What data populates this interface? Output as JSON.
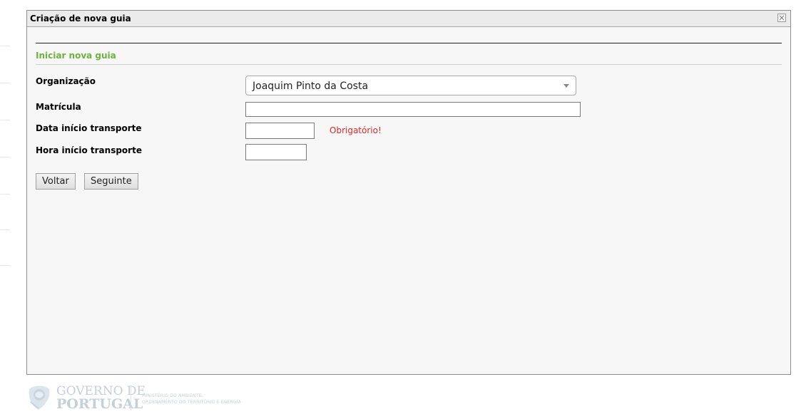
{
  "dialog": {
    "title": "Criação de nova guia",
    "close_icon": "close-x-icon"
  },
  "form": {
    "section_title": "Iniciar nova guia",
    "fields": {
      "organizacao": {
        "label": "Organização",
        "value": "Joaquim Pinto da Costa"
      },
      "matricula": {
        "label": "Matrícula",
        "value": ""
      },
      "data_inicio": {
        "label": "Data início transporte",
        "value": "",
        "validation": "Obrigatório!"
      },
      "hora_inicio": {
        "label": "Hora início transporte",
        "value": ""
      }
    },
    "buttons": {
      "back": "Voltar",
      "next": "Seguinte"
    }
  },
  "footer": {
    "logo_icon": "governo-portugal-emblem-icon",
    "gov_line1": "GOVERNO DE",
    "gov_line2": "PORTUGAL",
    "ministry_line1": "MINISTÉRIO DO AMBIENTE,",
    "ministry_line2": "ORDENAMENTO DO TERRITÓRIO E ENERGIA"
  },
  "colors": {
    "section_title": "#6cb33e",
    "validation": "#e0282a",
    "footer_logo": "#c3cfd9"
  }
}
